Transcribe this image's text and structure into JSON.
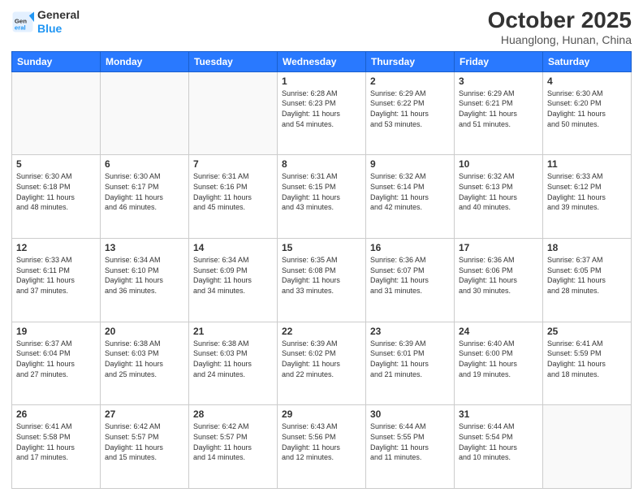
{
  "header": {
    "logo_line1": "General",
    "logo_line2": "Blue",
    "month": "October 2025",
    "location": "Huanglong, Hunan, China"
  },
  "weekdays": [
    "Sunday",
    "Monday",
    "Tuesday",
    "Wednesday",
    "Thursday",
    "Friday",
    "Saturday"
  ],
  "weeks": [
    [
      {
        "day": "",
        "info": ""
      },
      {
        "day": "",
        "info": ""
      },
      {
        "day": "",
        "info": ""
      },
      {
        "day": "1",
        "info": "Sunrise: 6:28 AM\nSunset: 6:23 PM\nDaylight: 11 hours\nand 54 minutes."
      },
      {
        "day": "2",
        "info": "Sunrise: 6:29 AM\nSunset: 6:22 PM\nDaylight: 11 hours\nand 53 minutes."
      },
      {
        "day": "3",
        "info": "Sunrise: 6:29 AM\nSunset: 6:21 PM\nDaylight: 11 hours\nand 51 minutes."
      },
      {
        "day": "4",
        "info": "Sunrise: 6:30 AM\nSunset: 6:20 PM\nDaylight: 11 hours\nand 50 minutes."
      }
    ],
    [
      {
        "day": "5",
        "info": "Sunrise: 6:30 AM\nSunset: 6:18 PM\nDaylight: 11 hours\nand 48 minutes."
      },
      {
        "day": "6",
        "info": "Sunrise: 6:30 AM\nSunset: 6:17 PM\nDaylight: 11 hours\nand 46 minutes."
      },
      {
        "day": "7",
        "info": "Sunrise: 6:31 AM\nSunset: 6:16 PM\nDaylight: 11 hours\nand 45 minutes."
      },
      {
        "day": "8",
        "info": "Sunrise: 6:31 AM\nSunset: 6:15 PM\nDaylight: 11 hours\nand 43 minutes."
      },
      {
        "day": "9",
        "info": "Sunrise: 6:32 AM\nSunset: 6:14 PM\nDaylight: 11 hours\nand 42 minutes."
      },
      {
        "day": "10",
        "info": "Sunrise: 6:32 AM\nSunset: 6:13 PM\nDaylight: 11 hours\nand 40 minutes."
      },
      {
        "day": "11",
        "info": "Sunrise: 6:33 AM\nSunset: 6:12 PM\nDaylight: 11 hours\nand 39 minutes."
      }
    ],
    [
      {
        "day": "12",
        "info": "Sunrise: 6:33 AM\nSunset: 6:11 PM\nDaylight: 11 hours\nand 37 minutes."
      },
      {
        "day": "13",
        "info": "Sunrise: 6:34 AM\nSunset: 6:10 PM\nDaylight: 11 hours\nand 36 minutes."
      },
      {
        "day": "14",
        "info": "Sunrise: 6:34 AM\nSunset: 6:09 PM\nDaylight: 11 hours\nand 34 minutes."
      },
      {
        "day": "15",
        "info": "Sunrise: 6:35 AM\nSunset: 6:08 PM\nDaylight: 11 hours\nand 33 minutes."
      },
      {
        "day": "16",
        "info": "Sunrise: 6:36 AM\nSunset: 6:07 PM\nDaylight: 11 hours\nand 31 minutes."
      },
      {
        "day": "17",
        "info": "Sunrise: 6:36 AM\nSunset: 6:06 PM\nDaylight: 11 hours\nand 30 minutes."
      },
      {
        "day": "18",
        "info": "Sunrise: 6:37 AM\nSunset: 6:05 PM\nDaylight: 11 hours\nand 28 minutes."
      }
    ],
    [
      {
        "day": "19",
        "info": "Sunrise: 6:37 AM\nSunset: 6:04 PM\nDaylight: 11 hours\nand 27 minutes."
      },
      {
        "day": "20",
        "info": "Sunrise: 6:38 AM\nSunset: 6:03 PM\nDaylight: 11 hours\nand 25 minutes."
      },
      {
        "day": "21",
        "info": "Sunrise: 6:38 AM\nSunset: 6:03 PM\nDaylight: 11 hours\nand 24 minutes."
      },
      {
        "day": "22",
        "info": "Sunrise: 6:39 AM\nSunset: 6:02 PM\nDaylight: 11 hours\nand 22 minutes."
      },
      {
        "day": "23",
        "info": "Sunrise: 6:39 AM\nSunset: 6:01 PM\nDaylight: 11 hours\nand 21 minutes."
      },
      {
        "day": "24",
        "info": "Sunrise: 6:40 AM\nSunset: 6:00 PM\nDaylight: 11 hours\nand 19 minutes."
      },
      {
        "day": "25",
        "info": "Sunrise: 6:41 AM\nSunset: 5:59 PM\nDaylight: 11 hours\nand 18 minutes."
      }
    ],
    [
      {
        "day": "26",
        "info": "Sunrise: 6:41 AM\nSunset: 5:58 PM\nDaylight: 11 hours\nand 17 minutes."
      },
      {
        "day": "27",
        "info": "Sunrise: 6:42 AM\nSunset: 5:57 PM\nDaylight: 11 hours\nand 15 minutes."
      },
      {
        "day": "28",
        "info": "Sunrise: 6:42 AM\nSunset: 5:57 PM\nDaylight: 11 hours\nand 14 minutes."
      },
      {
        "day": "29",
        "info": "Sunrise: 6:43 AM\nSunset: 5:56 PM\nDaylight: 11 hours\nand 12 minutes."
      },
      {
        "day": "30",
        "info": "Sunrise: 6:44 AM\nSunset: 5:55 PM\nDaylight: 11 hours\nand 11 minutes."
      },
      {
        "day": "31",
        "info": "Sunrise: 6:44 AM\nSunset: 5:54 PM\nDaylight: 11 hours\nand 10 minutes."
      },
      {
        "day": "",
        "info": ""
      }
    ]
  ]
}
